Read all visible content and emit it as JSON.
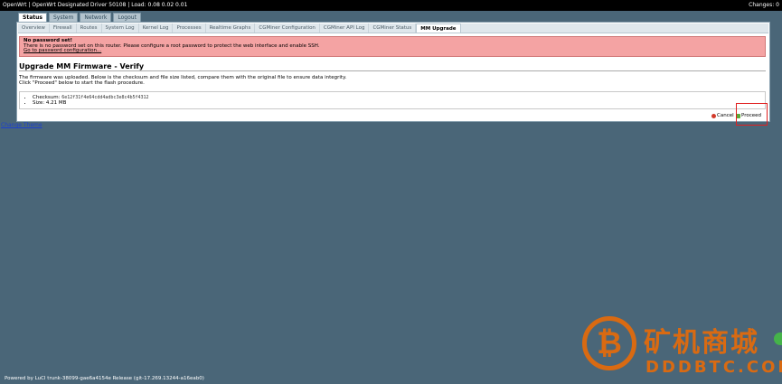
{
  "topbar": {
    "title": "OpenWrt | OpenWrt Designated Driver 50108 | Load: 0.08 0.02 0.01",
    "changes": "Changes: 0"
  },
  "main_tabs": [
    {
      "label": "Status",
      "active": true
    },
    {
      "label": "System",
      "active": false
    },
    {
      "label": "Network",
      "active": false
    },
    {
      "label": "Logout",
      "active": false
    }
  ],
  "sub_tabs": [
    {
      "label": "Overview",
      "active": false
    },
    {
      "label": "Firewall",
      "active": false
    },
    {
      "label": "Routes",
      "active": false
    },
    {
      "label": "System Log",
      "active": false
    },
    {
      "label": "Kernel Log",
      "active": false
    },
    {
      "label": "Processes",
      "active": false
    },
    {
      "label": "Realtime Graphs",
      "active": false
    },
    {
      "label": "CGMiner Configuration",
      "active": false
    },
    {
      "label": "CGMiner API Log",
      "active": false
    },
    {
      "label": "CGMiner Status",
      "active": false
    },
    {
      "label": "MM Upgrade",
      "active": true
    }
  ],
  "alert": {
    "title": "No password set!",
    "message": "There is no password set on this router. Please configure a root password to protect the web interface and enable SSH.",
    "link": "Go to password configuration..."
  },
  "page": {
    "heading": "Upgrade MM Firmware - Verify",
    "desc_line1": "The firmware was uploaded. Below is the checksum and file size listed, compare them with the original file to ensure data integrity.",
    "desc_line2": "Click \"Proceed\" below to start the flash procedure.",
    "checksum_label": "Checksum:",
    "checksum_value": "6e12f31f4e64cdd4adbc3e8c4b5f4312",
    "size_label": "Size:",
    "size_value": "4.21 MB"
  },
  "buttons": {
    "cancel": "Cancel",
    "proceed": "Proceed"
  },
  "links": {
    "change_theme": "Change Theme"
  },
  "footer": {
    "text": "Powered by LuCI trunk-38099-gae6a4154e Release (git-17.269.13244-a16eab0)"
  },
  "watermark": {
    "cn_text": "矿机商城",
    "en_text": "DDDBTC.COM"
  },
  "colors": {
    "background": "#4a6678",
    "alert_bg": "#f4a3a3",
    "highlight": "#e02020",
    "watermark": "#d96a12"
  }
}
